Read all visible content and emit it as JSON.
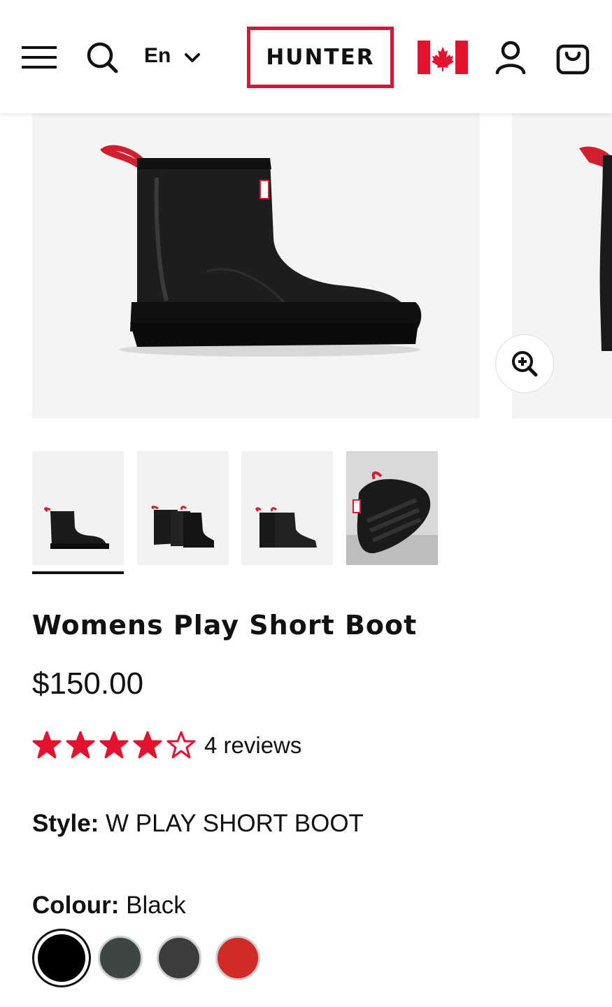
{
  "header": {
    "language": "En",
    "logo_text": "HUNTER",
    "accent_color": "#d3183a"
  },
  "product": {
    "title": "Womens Play Short Boot",
    "price": "$150.00",
    "rating": {
      "value": 4,
      "max": 5,
      "reviews_text": "4 reviews",
      "star_color": "#e4112f"
    },
    "style": {
      "label": "Style:",
      "value": "W PLAY SHORT BOOT"
    },
    "colour": {
      "label": "Colour:",
      "value": "Black",
      "swatches": [
        "#000000",
        "#3d4640",
        "#3b3c3d",
        "#d12b27"
      ],
      "selected_index": 0
    }
  },
  "gallery": {
    "thumbnail_count": 4,
    "selected_thumbnail": 0
  },
  "icons": [
    "menu-icon",
    "search-icon",
    "chevron-down-icon",
    "canada-flag-icon",
    "account-icon",
    "shopping-bag-icon",
    "zoom-in-icon",
    "star-icon"
  ]
}
